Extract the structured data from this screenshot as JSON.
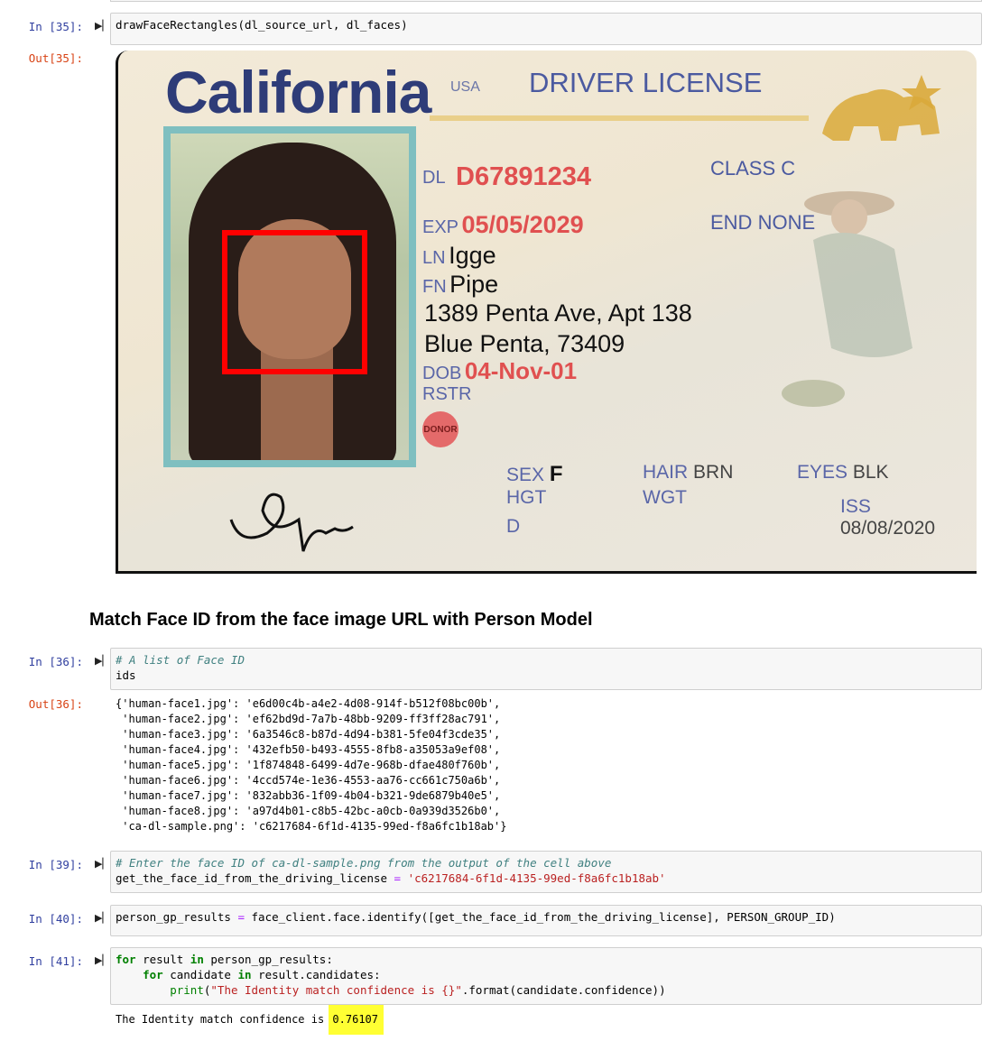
{
  "cells": {
    "c35": {
      "in_prompt": "In [35]:",
      "code": "drawFaceRectangles(dl_source_url, dl_faces)",
      "out_prompt": "Out[35]:"
    },
    "heading": "Match Face ID from the face image URL with Person Model",
    "c36": {
      "in_prompt": "In [36]:",
      "comment": "# A list of Face ID",
      "code": "ids",
      "out_prompt": "Out[36]:",
      "output_lines": [
        "{'human-face1.jpg': 'e6d00c4b-a4e2-4d08-914f-b512f08bc00b',",
        " 'human-face2.jpg': 'ef62bd9d-7a7b-48bb-9209-ff3ff28ac791',",
        " 'human-face3.jpg': '6a3546c8-b87d-4d94-b381-5fe04f3cde35',",
        " 'human-face4.jpg': '432efb50-b493-4555-8fb8-a35053a9ef08',",
        " 'human-face5.jpg': '1f874848-6499-4d7e-968b-dfae480f760b',",
        " 'human-face6.jpg': '4ccd574e-1e36-4553-aa76-cc661c750a6b',",
        " 'human-face7.jpg': '832abb36-1f09-4b04-b321-9de6879b40e5',",
        " 'human-face8.jpg': 'a97d4b01-c8b5-42bc-a0cb-0a939d3526b0',",
        " 'ca-dl-sample.png': 'c6217684-6f1d-4135-99ed-f8a6fc1b18ab'}"
      ]
    },
    "c39": {
      "in_prompt": "In [39]:",
      "comment": "# Enter the face ID of ca-dl-sample.png from the output of the cell above",
      "var": "get_the_face_id_from_the_driving_license",
      "eq": " = ",
      "value": "'c6217684-6f1d-4135-99ed-f8a6fc1b18ab'"
    },
    "c40": {
      "in_prompt": "In [40]:",
      "lhs": "person_gp_results",
      "eq": " = ",
      "rhs": "face_client.face.identify([get_the_face_id_from_the_driving_license], PERSON_GROUP_ID)"
    },
    "c41": {
      "in_prompt": "In [41]:",
      "l1_kw1": "for",
      "l1_mid": " result ",
      "l1_kw2": "in",
      "l1_rest": " person_gp_results:",
      "l2_indent": "    ",
      "l2_kw1": "for",
      "l2_mid": " candidate ",
      "l2_kw2": "in",
      "l2_rest": " result.candidates:",
      "l3_indent": "        ",
      "l3_fn": "print",
      "l3_open": "(",
      "l3_str": "\"The Identity match confidence is {}\"",
      "l3_rest": ".format(candidate.confidence))",
      "output_prefix": "The Identity match confidence is ",
      "output_value": "0.76107"
    }
  },
  "license": {
    "state": "California",
    "usa": "USA",
    "title": "DRIVER LICENSE",
    "dl_label": "DL",
    "dl_number": "D67891234",
    "exp_label": "EXP",
    "exp_value": "05/05/2029",
    "class_label": "CLASS",
    "class_value": "C",
    "end_label": "END",
    "end_value": "NONE",
    "ln_label": "LN",
    "ln_value": "Igge",
    "fn_label": "FN",
    "fn_value": "Pipe",
    "address1": "1389 Penta Ave, Apt 138",
    "address2": "Blue Penta, 73409",
    "dob_label": "DOB",
    "dob_value": "04-Nov-01",
    "rstr_label": "RSTR",
    "donor": "DONOR",
    "sex_label": "SEX",
    "sex_value": "F",
    "hgt_label": "HGT",
    "d_label": "D",
    "hair_label": "HAIR",
    "hair_value": "BRN",
    "wgt_label": "WGT",
    "eyes_label": "EYES",
    "eyes_value": "BLK",
    "iss_label": "ISS",
    "iss_value": "08/08/2020"
  }
}
